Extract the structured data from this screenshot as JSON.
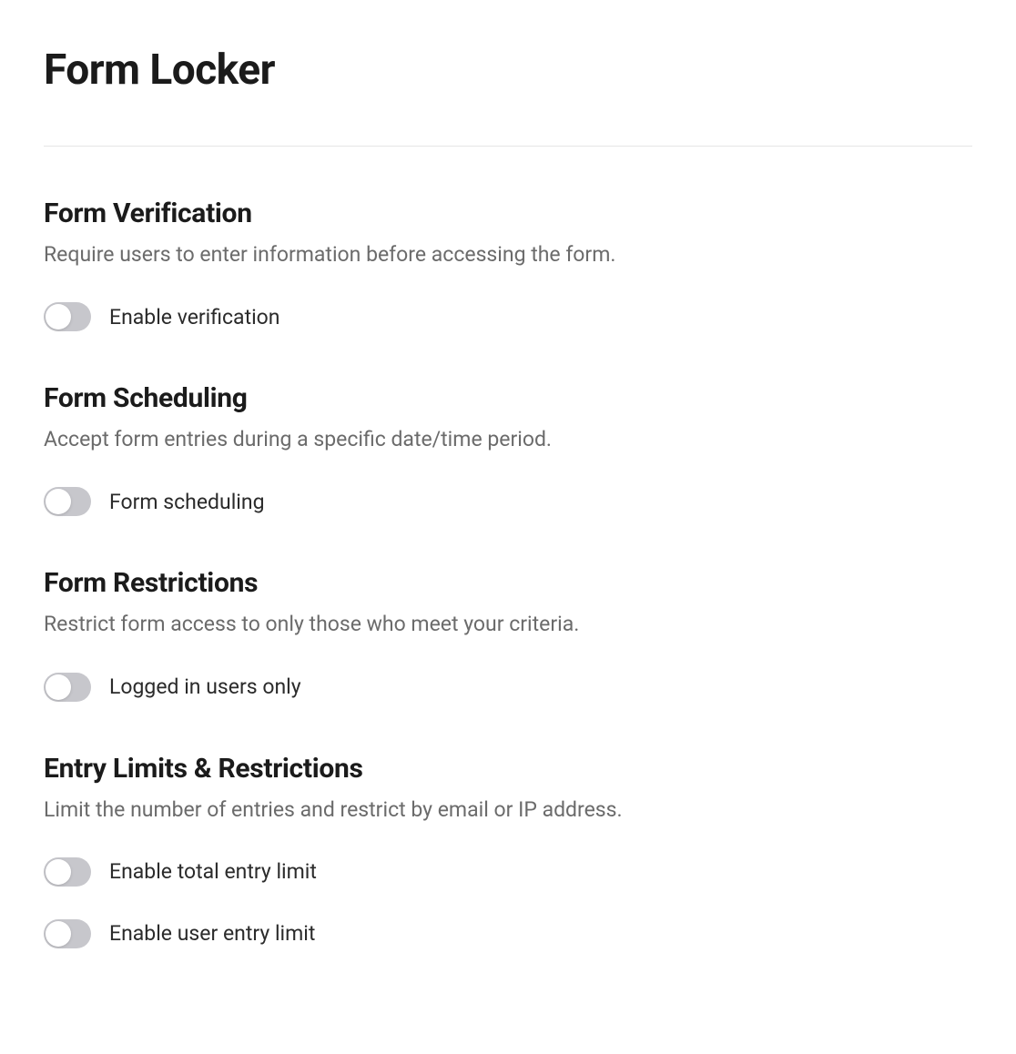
{
  "page": {
    "title": "Form Locker"
  },
  "sections": {
    "verification": {
      "title": "Form Verification",
      "desc": "Require users to enter information before accessing the form.",
      "toggle_label": "Enable verification"
    },
    "scheduling": {
      "title": "Form Scheduling",
      "desc": "Accept form entries during a specific date/time period.",
      "toggle_label": "Form scheduling"
    },
    "restrictions": {
      "title": "Form Restrictions",
      "desc": "Restrict form access to only those who meet your criteria.",
      "toggle_label": "Logged in users only"
    },
    "entry_limits": {
      "title": "Entry Limits & Restrictions",
      "desc": "Limit the number of entries and restrict by email or IP address.",
      "toggle_total_label": "Enable total entry limit",
      "toggle_user_label": "Enable user entry limit"
    }
  }
}
